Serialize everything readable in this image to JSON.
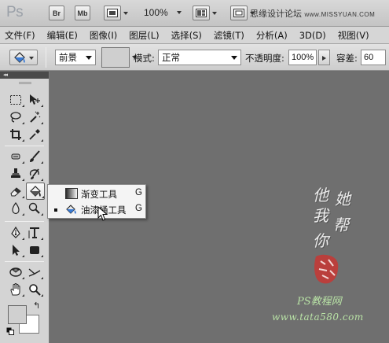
{
  "app": {
    "logo": "Ps",
    "bridge_label": "Br",
    "minibridge_label": "Mb",
    "zoom": "100%",
    "watermark_cn": "思缘设计论坛",
    "watermark_url": "www.MISSYUAN.COM"
  },
  "menu": [
    "文件(F)",
    "编辑(E)",
    "图像(I)",
    "图层(L)",
    "选择(S)",
    "滤镜(T)",
    "分析(A)",
    "3D(D)",
    "视图(V)"
  ],
  "options": {
    "fill_source": "前景",
    "mode_label": "模式:",
    "mode_value": "正常",
    "opacity_label": "不透明度:",
    "opacity_value": "100%",
    "tolerance_label": "容差:",
    "tolerance_value": "60"
  },
  "toolbox": {
    "collapse_label": "◂◂",
    "foreground_color": "#d0d0d0",
    "background_color": "#ffffff"
  },
  "flyout": {
    "items": [
      {
        "label": "渐变工具",
        "shortcut": "G",
        "selected": false
      },
      {
        "label": "油漆桶工具",
        "shortcut": "G",
        "selected": true
      }
    ]
  },
  "canvas": {
    "signature_chars": [
      "他",
      "她",
      "我",
      "帮",
      "你"
    ],
    "site_name": "PS教程网",
    "site_url": "www.tata580.com"
  }
}
